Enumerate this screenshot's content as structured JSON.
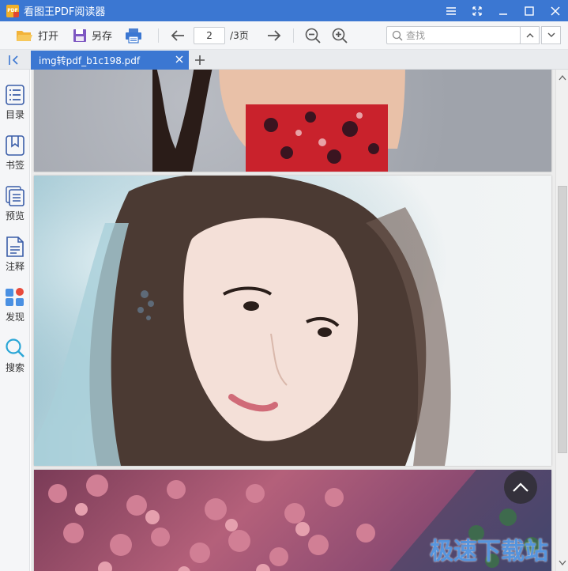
{
  "app": {
    "title": "看图王PDF阅读器",
    "logo_text": "PDF"
  },
  "window_controls": [
    "menu-icon",
    "fullscreen-icon",
    "minimize-icon",
    "maximize-icon",
    "close-icon"
  ],
  "toolbar": {
    "open_label": "打开",
    "saveas_label": "另存",
    "current_page": "2",
    "total_pages": "/3页",
    "search_placeholder": "查找"
  },
  "tab": {
    "title": "img转pdf_b1c198.pdf"
  },
  "sidebar": {
    "items": [
      {
        "label": "目录",
        "icon": "catalog-icon"
      },
      {
        "label": "书签",
        "icon": "bookmark-icon"
      },
      {
        "label": "预览",
        "icon": "preview-icon"
      },
      {
        "label": "注释",
        "icon": "annotation-icon"
      },
      {
        "label": "发现",
        "icon": "discover-icon"
      },
      {
        "label": "搜索",
        "icon": "search-icon"
      }
    ]
  },
  "watermark": "极速下载站",
  "colors": {
    "accent": "#3b77d2",
    "toolbar_bg": "#f5f6f8"
  }
}
